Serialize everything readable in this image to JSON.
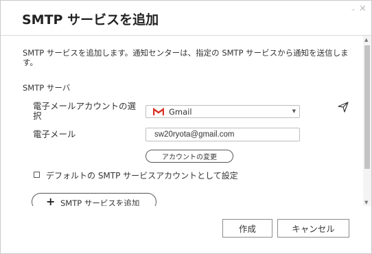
{
  "window": {
    "title": "SMTP サービスを追加",
    "minimize_glyph": "–",
    "close_glyph": "×"
  },
  "description": "SMTP サービスを追加します。通知センターは、指定の SMTP サービスから通知を送信します。",
  "section_title": "SMTP サーバ",
  "email_account": {
    "label": "電子メールアカウントの選択",
    "selected": "Gmail",
    "icon": "gmail-icon",
    "test_icon": "send-icon"
  },
  "email": {
    "label": "電子メール",
    "value": "sw20ryota@gmail.com",
    "change_button": "アカウントの変更"
  },
  "default_checkbox": {
    "label": "デフォルトの SMTP サービスアカウントとして設定",
    "checked": false
  },
  "add_service": {
    "icon": "plus-icon",
    "label": "SMTP サービスを追加"
  },
  "buttons": {
    "create": "作成",
    "cancel": "キャンセル"
  },
  "colors": {
    "gmail_red": "#d93025",
    "scroll_thumb": "#c3c3c3"
  }
}
